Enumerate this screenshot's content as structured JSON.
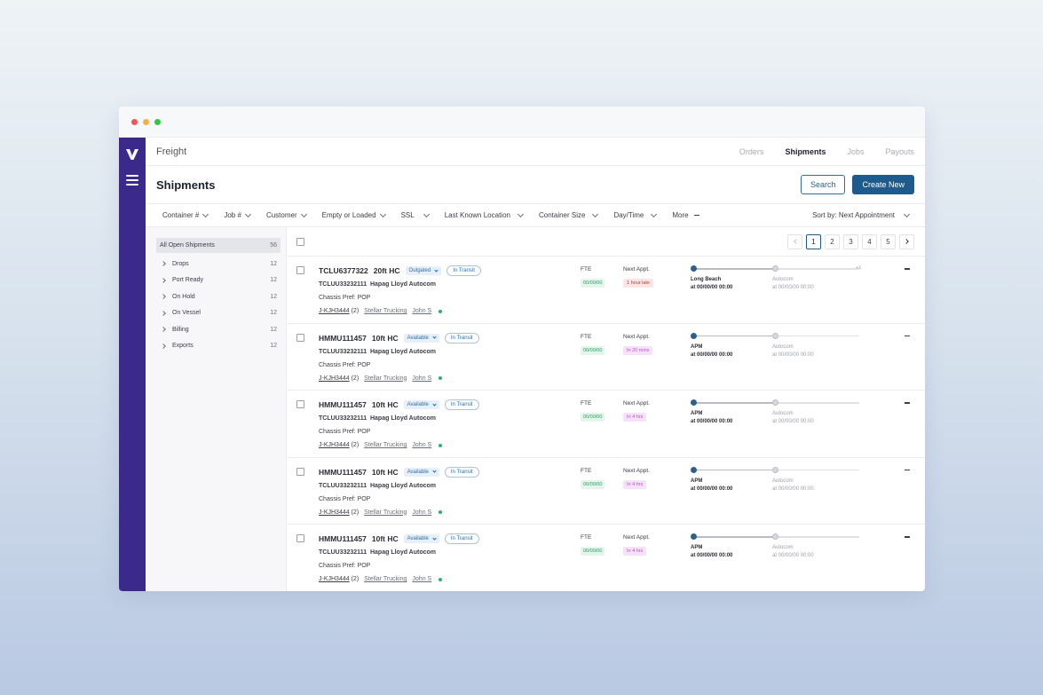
{
  "app": {
    "brand": "Freight"
  },
  "nav": {
    "tabs": [
      "Orders",
      "Shipments",
      "Jobs",
      "Payouts"
    ],
    "active": "Shipments"
  },
  "header": {
    "title": "Shipments",
    "search_label": "Search",
    "create_label": "Create New"
  },
  "filters": {
    "items": [
      "Container #",
      "Job #",
      "Customer",
      "Empty or Loaded",
      "SSL",
      "Last Known Location",
      "Container Size",
      "Day/Time"
    ],
    "more_label": "More",
    "sort_label": "Sort by: Next Appointment"
  },
  "sidebar": {
    "all": {
      "label": "All Open Shipments",
      "count": "56"
    },
    "items": [
      {
        "label": "Drops",
        "count": "12"
      },
      {
        "label": "Port Ready",
        "count": "12"
      },
      {
        "label": "On Hold",
        "count": "12"
      },
      {
        "label": "On Vessel",
        "count": "12"
      },
      {
        "label": "Billing",
        "count": "12"
      },
      {
        "label": "Exports",
        "count": "12"
      }
    ]
  },
  "pagination": {
    "pages": [
      "1",
      "2",
      "3",
      "4",
      "5"
    ],
    "current": "1"
  },
  "shipments": [
    {
      "container": "TCLU6377322",
      "size": "20ft HC",
      "status": "Outgated",
      "transit": "In Transit",
      "booking": "TCLUU33232111",
      "line": "Hapag Lloyd Autocom",
      "chassis": "Chassis Pref: POP",
      "job": "J-KJH3444",
      "job_count": "(2)",
      "carrier": "Stellar Trucking",
      "driver": "John S",
      "fte_label": "FTE",
      "fte_date": "00/00/00",
      "appt_label": "Next Appt.",
      "appt_status": "1 hour late",
      "appt_tone": "red",
      "origin": "Long Beach",
      "origin_time": "at 00/00/00 00:00",
      "destination": "Autocom",
      "destination_time": "at 00/00/00 00:00",
      "extra_stops": "+1"
    },
    {
      "container": "HMMU111457",
      "size": "10ft HC",
      "status": "Available",
      "transit": "In Transit",
      "booking": "TCLUU33232111",
      "line": "Hapag Lloyd Autocom",
      "chassis": "Chassis Pref: POP",
      "job": "J-KJH3444",
      "job_count": "(2)",
      "carrier": "Stellar Trucking",
      "driver": "John S",
      "fte_label": "FTE",
      "fte_date": "00/00/00",
      "appt_label": "Next Appt.",
      "appt_status": "In 20 mins",
      "appt_tone": "pink",
      "origin": "APM",
      "origin_time": "at 00/00/00 00:00",
      "destination": "Autocom",
      "destination_time": "at 00/00/00 00:00",
      "extra_stops": ""
    },
    {
      "container": "HMMU111457",
      "size": "10ft HC",
      "status": "Available",
      "transit": "In Transit",
      "booking": "TCLUU33232111",
      "line": "Hapag Lloyd Autocom",
      "chassis": "Chassis Pref: POP",
      "job": "J-KJH3444",
      "job_count": "(2)",
      "carrier": "Stellar Trucking",
      "driver": "John S",
      "fte_label": "FTE",
      "fte_date": "00/00/00",
      "appt_label": "Next Appt.",
      "appt_status": "In 4 hrs",
      "appt_tone": "pink",
      "origin": "APM",
      "origin_time": "at 00/00/00 00:00",
      "destination": "Autocom",
      "destination_time": "at 00/00/00 00:00",
      "extra_stops": ""
    },
    {
      "container": "HMMU111457",
      "size": "10ft HC",
      "status": "Available",
      "transit": "In Transit",
      "booking": "TCLUU33232111",
      "line": "Hapag Lloyd Autocom",
      "chassis": "Chassis Pref: POP",
      "job": "J-KJH3444",
      "job_count": "(2)",
      "carrier": "Stellar Trucking",
      "driver": "John S",
      "fte_label": "FTE",
      "fte_date": "00/00/00",
      "appt_label": "Next Appt.",
      "appt_status": "In 4 hrs",
      "appt_tone": "pink",
      "origin": "APM",
      "origin_time": "at 00/00/00 00:00",
      "destination": "Autocom",
      "destination_time": "at 00/00/00 00:00",
      "extra_stops": ""
    },
    {
      "container": "HMMU111457",
      "size": "10ft HC",
      "status": "Available",
      "transit": "In Transit",
      "booking": "TCLUU33232111",
      "line": "Hapag Lloyd Autocom",
      "chassis": "Chassis Pref: POP",
      "job": "J-KJH3444",
      "job_count": "(2)",
      "carrier": "Stellar Trucking",
      "driver": "John S",
      "fte_label": "FTE",
      "fte_date": "00/00/00",
      "appt_label": "Next Appt.",
      "appt_status": "In 4 hrs",
      "appt_tone": "pink",
      "origin": "APM",
      "origin_time": "at 00/00/00 00:00",
      "destination": "Autocom",
      "destination_time": "at 00/00/00 00:00",
      "extra_stops": ""
    }
  ],
  "icons": {
    "logo": "v-logo-icon",
    "menu": "hamburger-menu-icon",
    "chevron": "chevron-down-icon",
    "more": "more-dash-icon",
    "online": "online-dot-icon",
    "stop": "route-stop-icon"
  },
  "colors": {
    "sidebar_rail": "#3b2a8c",
    "primary": "#1e5a8c",
    "window_red": "#f2545b",
    "window_yellow": "#f7b13a",
    "window_green": "#35c44b",
    "late_red": "#c23b3b",
    "soon_pink": "#b455c6",
    "date_green": "#2a9d67"
  }
}
